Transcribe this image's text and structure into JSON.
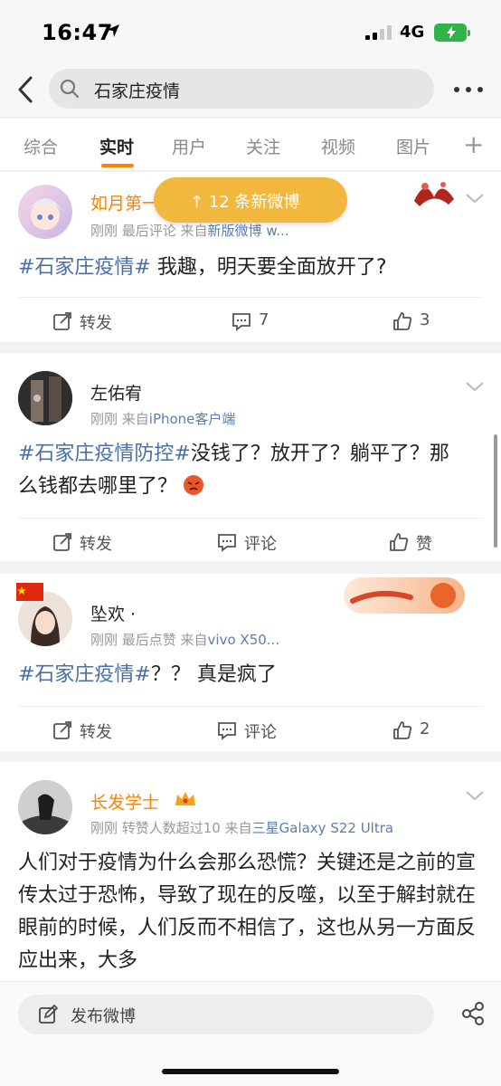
{
  "status_bar": {
    "time": "16:47",
    "network": "4G"
  },
  "search": {
    "query": "石家庄疫情"
  },
  "tabs": [
    {
      "label": "综合",
      "active": false
    },
    {
      "label": "实时",
      "active": true
    },
    {
      "label": "用户",
      "active": false
    },
    {
      "label": "关注",
      "active": false
    },
    {
      "label": "视频",
      "active": false
    },
    {
      "label": "图片",
      "active": false
    }
  ],
  "tab_add": "+",
  "new_posts_pill": "↑ 12 条新微博",
  "colors": {
    "accent": "#ff8200",
    "link": "#4a6fa5",
    "pill": "#f2b83d"
  },
  "posts": [
    {
      "username": "如月第一",
      "meta_prefix": "刚刚  最后评论  来自",
      "source": "新版微博 w...",
      "hashtag": "#石家庄疫情#",
      "text": " 我趣，明天要全面放开了?",
      "repost": "转发",
      "comments": "7",
      "likes": "3"
    },
    {
      "username": "左佑宥",
      "meta_prefix": "刚刚  来自",
      "source": "iPhone客户端",
      "hashtag": "#石家庄疫情防控#",
      "text": "没钱了？放开了？躺平了？那么钱都去哪里了？",
      "emoji": "angry-emoji",
      "repost": "转发",
      "comments": "评论",
      "likes": "赞"
    },
    {
      "username": "坠欢 ·",
      "meta_prefix": "刚刚  最后点赞  来自",
      "source": "vivo X50...",
      "hashtag": "#石家庄疫情#",
      "text": "？？ 真是疯了",
      "repost": "转发",
      "comments": "评论",
      "likes": "2"
    },
    {
      "username": "长发学士",
      "meta_prefix": "刚刚  转赞人数超过10  来自",
      "source": "三星Galaxy S22 Ultra",
      "text": "人们对于疫情为什么会那么恐慌？关键还是之前的宣传太过于恐怖，导致了现在的反噬，以至于解封就在眼前的时候，人们反而不相信了，这也从另一方面反应出来，大多"
    }
  ],
  "bottom": {
    "post_label": "发布微博"
  }
}
